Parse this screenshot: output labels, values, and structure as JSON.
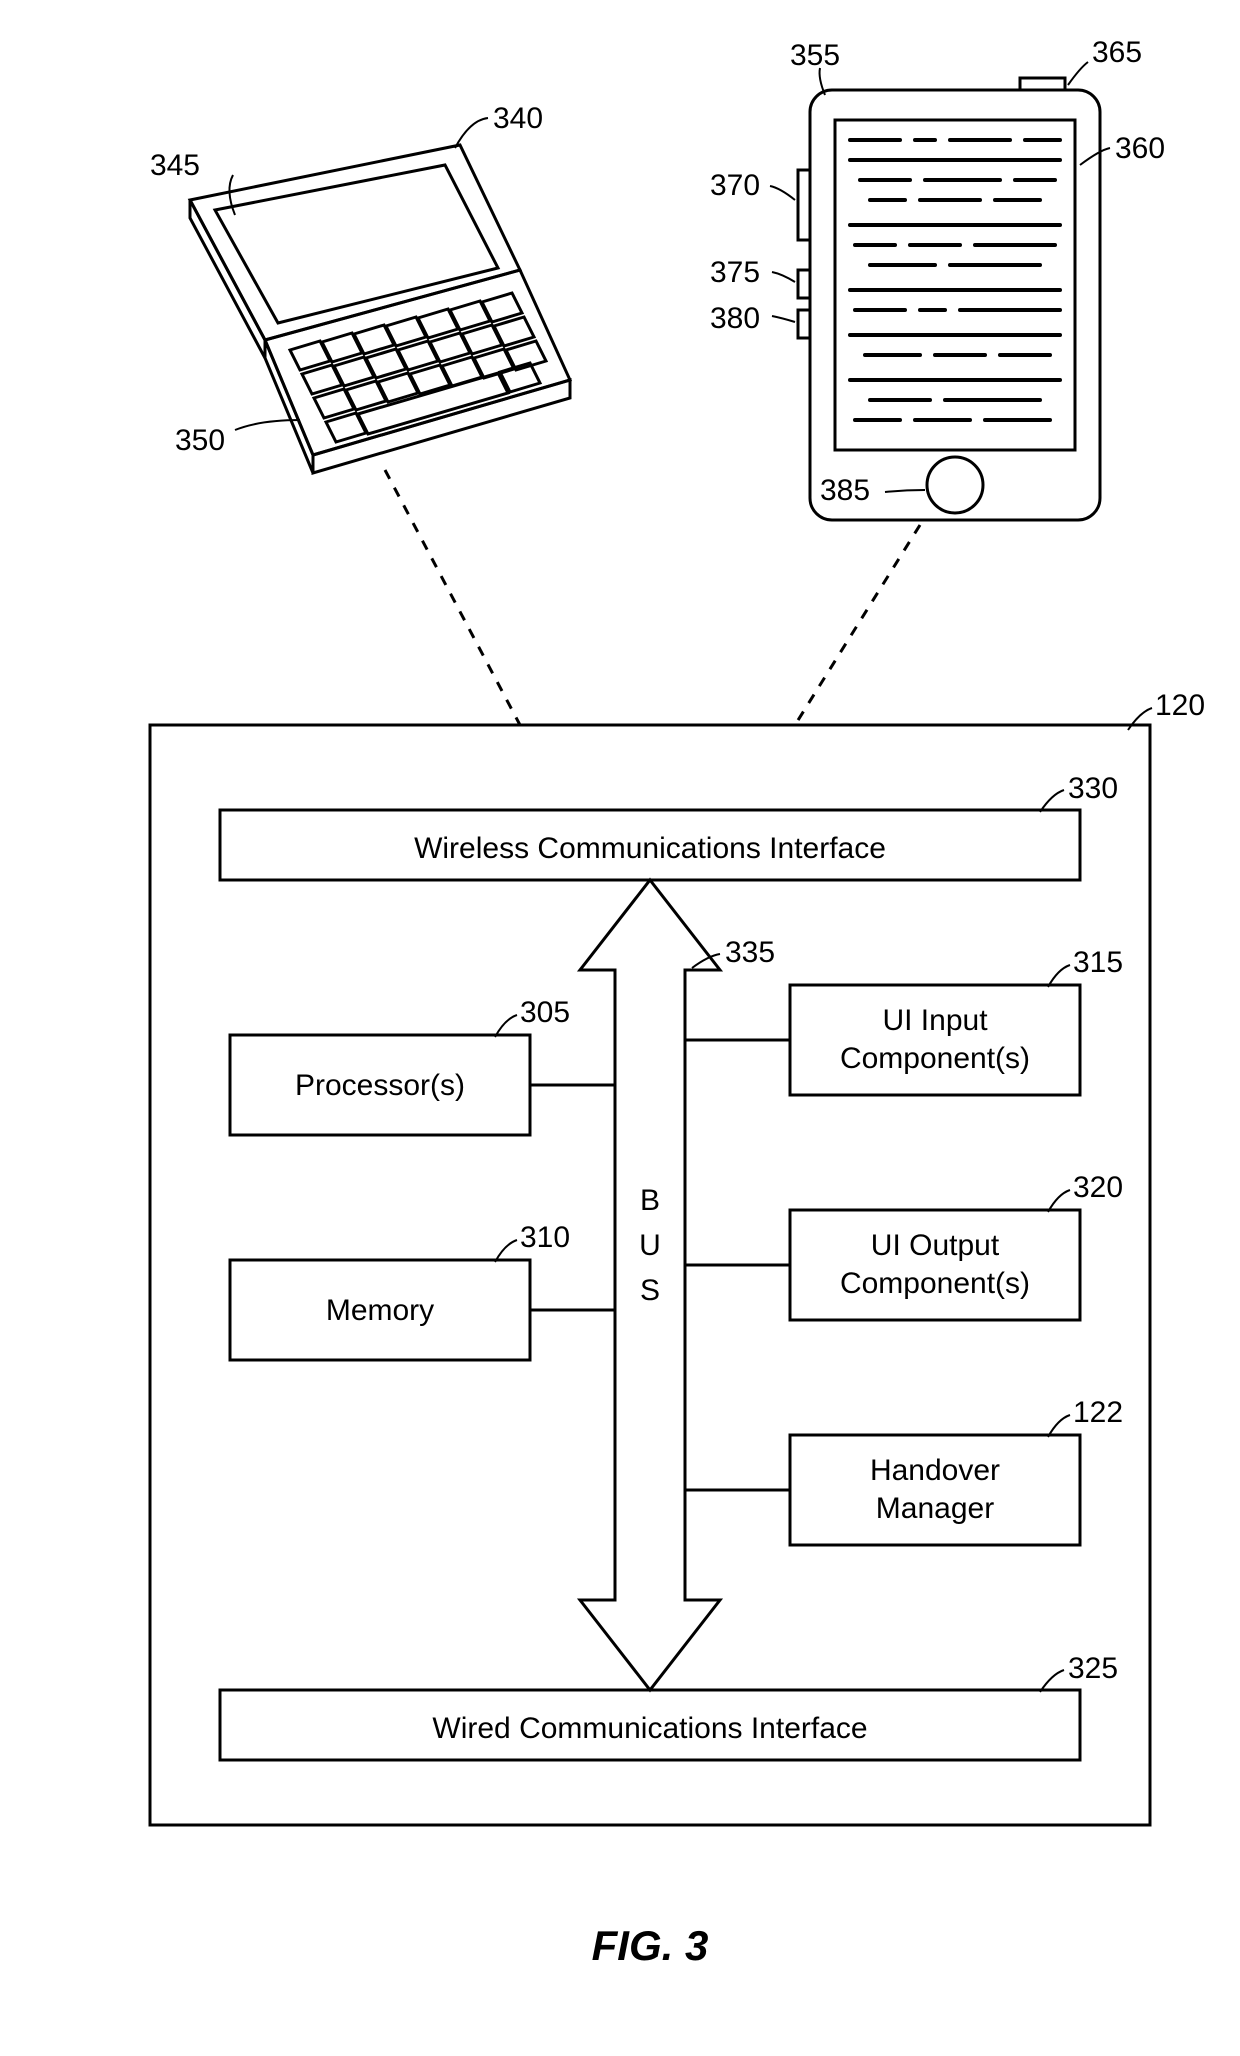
{
  "figure_caption": "FIG. 3",
  "ref": {
    "r120": "120",
    "r122": "122",
    "r305": "305",
    "r310": "310",
    "r315": "315",
    "r320": "320",
    "r325": "325",
    "r330": "330",
    "r335": "335",
    "r340": "340",
    "r345": "345",
    "r350": "350",
    "r355": "355",
    "r360": "360",
    "r365": "365",
    "r370": "370",
    "r375": "375",
    "r380": "380",
    "r385": "385"
  },
  "blocks": {
    "wireless": "Wireless Communications Interface",
    "wired": "Wired Communications Interface",
    "processor": "Processor(s)",
    "memory": "Memory",
    "ui_input_l1": "UI Input",
    "ui_input_l2": "Component(s)",
    "ui_output_l1": "UI Output",
    "ui_output_l2": "Component(s)",
    "handover_l1": "Handover",
    "handover_l2": "Manager",
    "bus_l1": "B",
    "bus_l2": "U",
    "bus_l3": "S"
  }
}
